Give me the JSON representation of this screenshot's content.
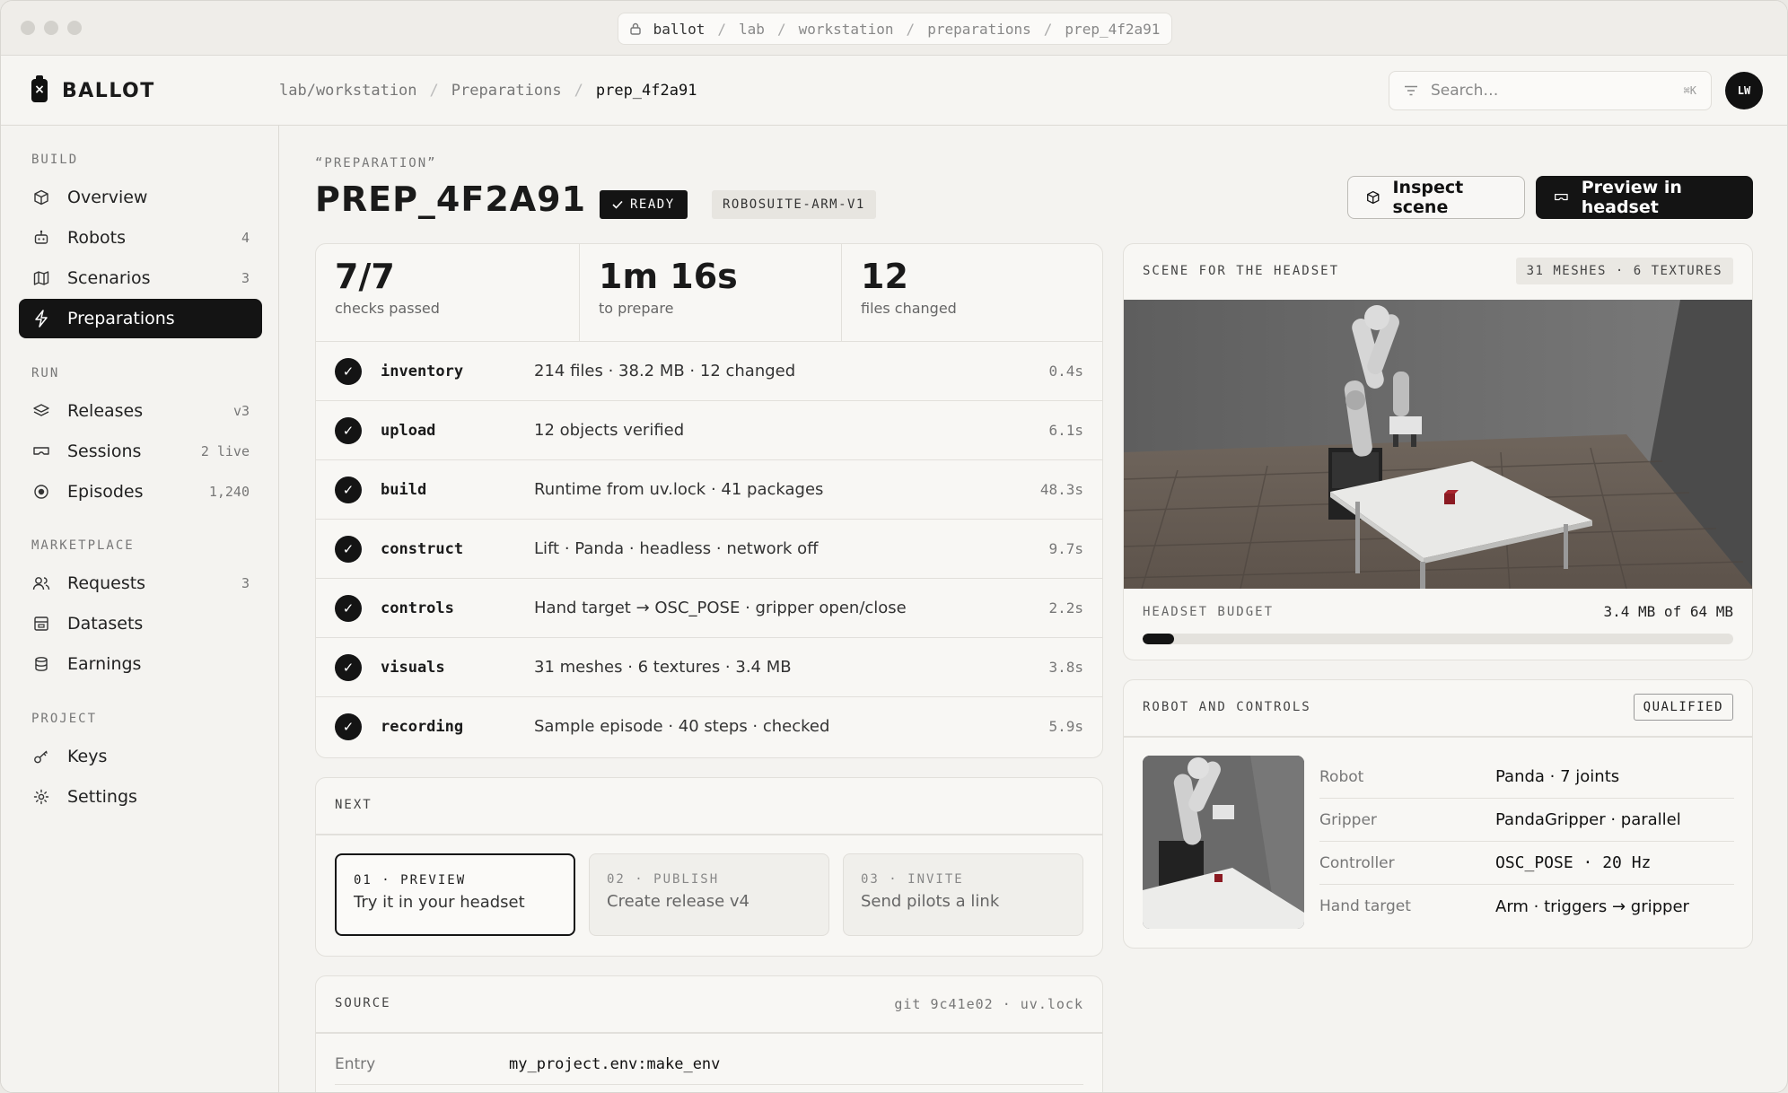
{
  "browser": {
    "url_parts": [
      "ballot",
      "lab",
      "workstation",
      "preparations",
      "prep_4f2a91"
    ]
  },
  "header": {
    "brand": "BALLOT",
    "breadcrumbs": [
      "lab/workstation",
      "Preparations",
      "prep_4f2a91"
    ],
    "search_placeholder": "Search…",
    "search_shortcut": "⌘K",
    "avatar_initials": "LW"
  },
  "sidebar": {
    "sections": [
      {
        "label": "BUILD",
        "items": [
          {
            "label": "Overview",
            "icon": "cube-icon",
            "count": ""
          },
          {
            "label": "Robots",
            "icon": "robot-icon",
            "count": "4"
          },
          {
            "label": "Scenarios",
            "icon": "map-icon",
            "count": "3"
          },
          {
            "label": "Preparations",
            "icon": "lightning-icon",
            "count": "",
            "active": true
          }
        ]
      },
      {
        "label": "RUN",
        "items": [
          {
            "label": "Releases",
            "icon": "layers-icon",
            "count": "v3"
          },
          {
            "label": "Sessions",
            "icon": "headset-icon",
            "count": "2 live"
          },
          {
            "label": "Episodes",
            "icon": "record-icon",
            "count": "1,240"
          }
        ]
      },
      {
        "label": "MARKETPLACE",
        "items": [
          {
            "label": "Requests",
            "icon": "users-icon",
            "count": "3"
          },
          {
            "label": "Datasets",
            "icon": "archive-icon",
            "count": ""
          },
          {
            "label": "Earnings",
            "icon": "coins-icon",
            "count": ""
          }
        ]
      },
      {
        "label": "PROJECT",
        "items": [
          {
            "label": "Keys",
            "icon": "key-icon",
            "count": ""
          },
          {
            "label": "Settings",
            "icon": "gear-icon",
            "count": ""
          }
        ]
      }
    ]
  },
  "page": {
    "kicker": "“PREPARATION”",
    "title": "PREP_4F2A91",
    "status": "READY",
    "env": "ROBOSUITE-ARM-V1",
    "inspect_label": "Inspect scene",
    "preview_label": "Preview in headset"
  },
  "stats": [
    {
      "value": "7/7",
      "label": "checks passed"
    },
    {
      "value": "1m 16s",
      "label": "to prepare"
    },
    {
      "value": "12",
      "label": "files changed"
    }
  ],
  "checks": [
    {
      "name": "inventory",
      "desc": "214 files · 38.2 MB · 12 changed",
      "time": "0.4s"
    },
    {
      "name": "upload",
      "desc": "12 objects verified",
      "time": "6.1s"
    },
    {
      "name": "build",
      "desc": "Runtime from uv.lock · 41 packages",
      "time": "48.3s"
    },
    {
      "name": "construct",
      "desc": "Lift · Panda · headless · network off",
      "time": "9.7s"
    },
    {
      "name": "controls",
      "desc": "Hand target → OSC_POSE · gripper open/close",
      "time": "2.2s"
    },
    {
      "name": "visuals",
      "desc": "31 meshes · 6 textures · 3.4 MB",
      "time": "3.8s"
    },
    {
      "name": "recording",
      "desc": "Sample episode · 40 steps · checked",
      "time": "5.9s"
    }
  ],
  "next": {
    "label": "NEXT",
    "steps": [
      {
        "key": "01 · PREVIEW",
        "text": "Try it in your headset",
        "selected": true
      },
      {
        "key": "02 · PUBLISH",
        "text": "Create release v4",
        "selected": false
      },
      {
        "key": "03 · INVITE",
        "text": "Send pilots a link",
        "selected": false
      }
    ]
  },
  "source": {
    "label": "SOURCE",
    "meta": "git 9c41e02 · uv.lock",
    "entry_key": "Entry",
    "entry_value": "my_project.env:make_env"
  },
  "scene": {
    "label": "SCENE FOR THE HEADSET",
    "tag": "31 MESHES · 6 TEXTURES",
    "budget_label": "HEADSET BUDGET",
    "budget_value": "3.4 MB of 64 MB",
    "budget_fraction": 0.053
  },
  "robot_card": {
    "label": "ROBOT AND CONTROLS",
    "badge": "QUALIFIED",
    "specs": [
      {
        "key": "Robot",
        "value": "Panda · 7 joints"
      },
      {
        "key": "Gripper",
        "value": "PandaGripper · parallel"
      },
      {
        "key": "Controller",
        "value": "OSC_POSE · 20 Hz"
      },
      {
        "key": "Hand target",
        "value": "Arm · triggers → gripper"
      }
    ]
  }
}
